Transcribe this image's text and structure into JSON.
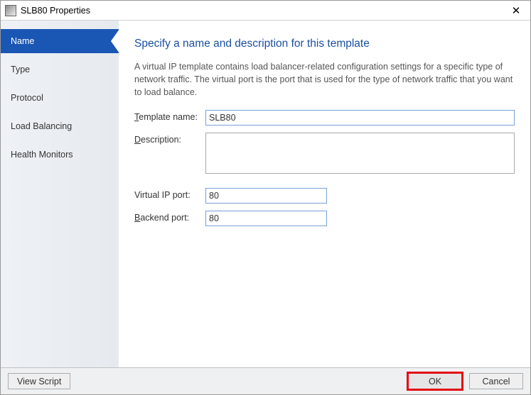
{
  "window": {
    "title": "SLB80 Properties",
    "close_glyph": "✕"
  },
  "sidebar": {
    "items": [
      {
        "label": "Name",
        "active": true
      },
      {
        "label": "Type"
      },
      {
        "label": "Protocol"
      },
      {
        "label": "Load Balancing"
      },
      {
        "label": "Health Monitors"
      }
    ]
  },
  "content": {
    "heading": "Specify a name and description for this template",
    "intro": "A virtual IP template contains load balancer-related configuration settings for a specific type of network traffic. The virtual port is the port that is used for the type of network traffic that you want to load balance.",
    "fields": {
      "template_name": {
        "label_pre": "T",
        "label_post": "emplate name:",
        "value": "SLB80"
      },
      "description": {
        "label_pre": "D",
        "label_post": "escription:",
        "value": ""
      },
      "virtual_port": {
        "label_full": "Virtual IP port:",
        "value": "80"
      },
      "backend_port": {
        "label_pre": "B",
        "label_post": "ackend port:",
        "value": "80"
      }
    }
  },
  "footer": {
    "view_script": "View Script",
    "ok": "OK",
    "cancel": "Cancel"
  }
}
